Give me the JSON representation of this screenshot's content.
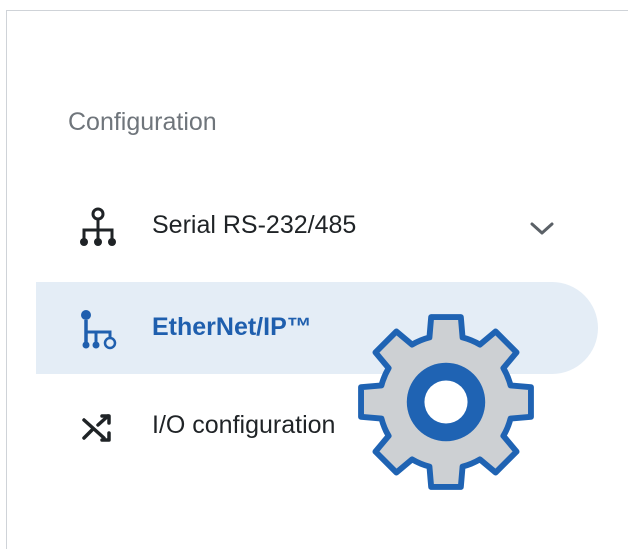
{
  "sidebar": {
    "section_title": "Configuration",
    "items": [
      {
        "label": "Serial RS-232/485",
        "icon": "network-tree-icon",
        "expandable": true,
        "active": false
      },
      {
        "label": "EtherNet/IP™",
        "icon": "ethernet-ip-icon",
        "active": true
      },
      {
        "label": "I/O configuration",
        "icon": "shuffle-icon",
        "active": false
      }
    ]
  },
  "colors": {
    "active_background": "#e4edf6",
    "active_text": "#1f5fae",
    "section_text": "#6f757b",
    "text": "#1f2326",
    "gear_fill": "#cdd0d3",
    "gear_accent": "#1f63b3"
  },
  "overlay": {
    "icon": "gear-icon"
  }
}
